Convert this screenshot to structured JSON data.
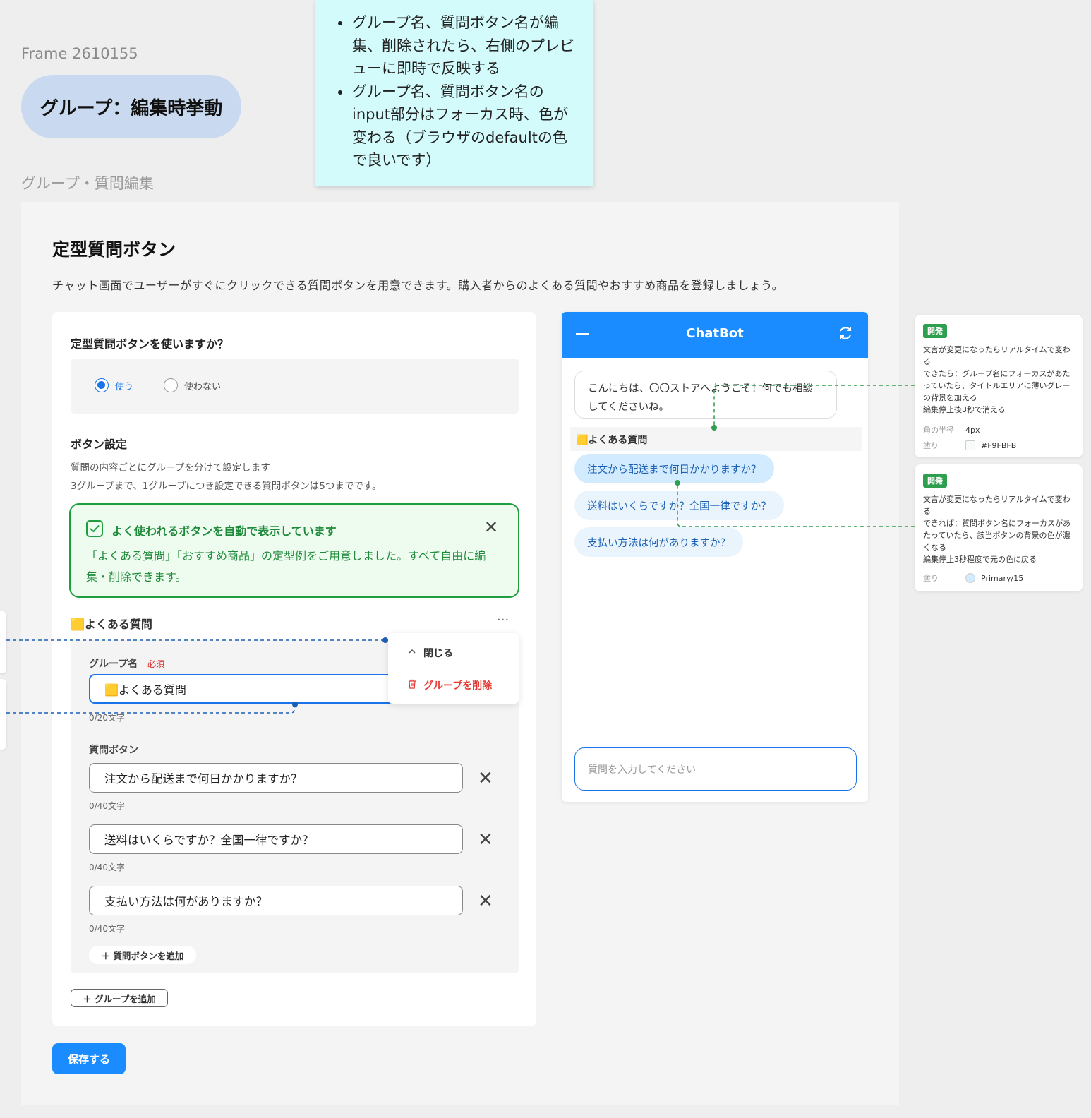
{
  "frame_label": "Frame 2610155",
  "pill_title": "グループ：編集時挙動",
  "sticky_notes": [
    "グループ名、質問ボタン名が編集、削除されたら、右側のプレビューに即時で反映する",
    "グループ名、質問ボタン名のinput部分はフォーカス時、色が変わる（ブラウザのdefaultの色で良いです）"
  ],
  "section_label": "グループ・質問編集",
  "page": {
    "title": "定型質問ボタン",
    "description": "チャット画面でユーザーがすぐにクリックできる質問ボタンを用意できます。購入者からのよくある質問やおすすめ商品を登録しましょう。"
  },
  "use_question": {
    "title": "定型質問ボタンを使いますか？",
    "options": [
      "使う",
      "使わない"
    ],
    "selected": "使う"
  },
  "button_settings": {
    "title": "ボタン設定",
    "desc_line1": "質問の内容ごとにグループを分けて設定します。",
    "desc_line2": "3グループまで、1グループにつき設定できる質問ボタンは5つまでです。"
  },
  "alert": {
    "title": "よく使われるボタンを自動で表示しています",
    "body": "「よくある質問」「おすすめ商品」の定型例をご用意しました。すべて自由に編集・削除できます。",
    "close": "✕"
  },
  "group": {
    "header": "🟨よくある質問",
    "menu_dots": "···",
    "name_label": "グループ名",
    "required": "必須",
    "name_value": "🟨よくある質問",
    "name_counter": "0/20文字",
    "questions_label": "質問ボタン",
    "questions": [
      {
        "value": "注文から配送まで何日かかりますか？",
        "counter": "0/40文字"
      },
      {
        "value": "送料はいくらですか？全国一律ですか？",
        "counter": "0/40文字"
      },
      {
        "value": "支払い方法は何がありますか？",
        "counter": "0/40文字"
      }
    ],
    "add_question": "＋ 質問ボタンを追加"
  },
  "menu": {
    "close": "閉じる",
    "delete": "グループを削除"
  },
  "add_group": "＋ グループを追加",
  "save": "保存する",
  "chatbot": {
    "title": "ChatBot",
    "greeting_line1": "こんにちは、〇〇ストアへようこそ！何でも相談",
    "greeting_line2": "してくださいね。",
    "faq_header": "🟨よくある質問",
    "questions": [
      "注文から配送まで何日かかりますか？",
      "送料はいくらですか？全国一律ですか？",
      "支払い方法は何がありますか？"
    ],
    "input_placeholder": "質問を入力してください"
  },
  "dev_notes": [
    {
      "tag": "開発",
      "lines": [
        "文言が変更になったらリアルタイムで変わる",
        "できたら：グループ名にフォーカスがあたっていたら、タイトルエリアに薄いグレーの背景を加える",
        "編集停止後3秒で消える"
      ],
      "props": [
        {
          "k": "角の半径",
          "v": "4px"
        },
        {
          "k": "塗り",
          "v": "#F9FBFB",
          "swatch": "#F9FBFB"
        }
      ]
    },
    {
      "tag": "開発",
      "lines": [
        "文言が変更になったらリアルタイムで変わる",
        "できれば：質問ボタン名にフォーカスがあたっていたら、該当ボタンの背景の色が濃くなる",
        "編集停止3秒程度で元の色に戻る"
      ],
      "props": [
        {
          "k": "塗り",
          "v": "Primary/15",
          "swatch": "#d3ebff"
        }
      ]
    }
  ],
  "colors": {
    "primary": "#1a8cff",
    "success": "#1f9e3f",
    "danger": "#e53935",
    "dev_tag": "#2e9e4f"
  }
}
